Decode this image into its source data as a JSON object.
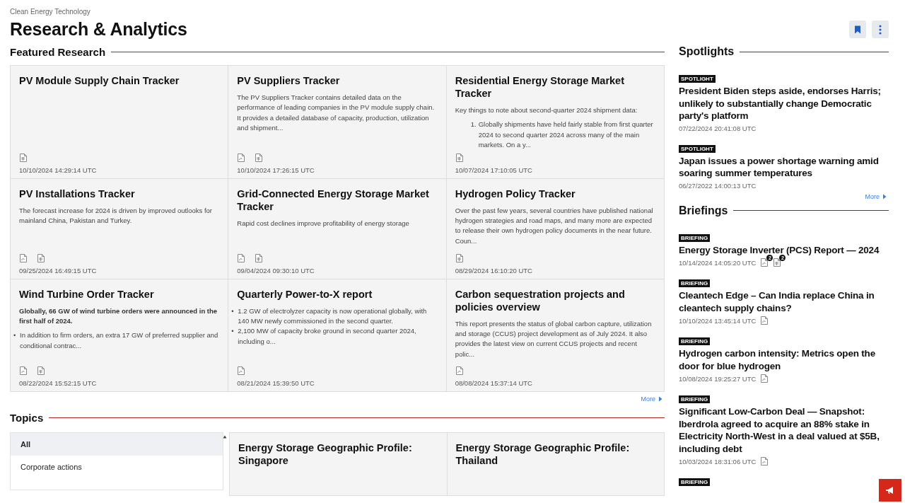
{
  "breadcrumb": "Clean Energy Technology",
  "title": "Research & Analytics",
  "actions": [
    {
      "kind": "bookmark"
    },
    {
      "kind": "more"
    }
  ],
  "featured": {
    "title": "Featured Research",
    "more": "More",
    "items": [
      {
        "title": "PV Module Supply Chain Tracker",
        "files": [
          {
            "kind": "xls"
          }
        ],
        "date": "10/10/2024 14:29:14 UTC"
      },
      {
        "title": "PV Suppliers Tracker",
        "body": [
          {
            "kind": "paragraph",
            "text": "The PV Suppliers Tracker contains detailed data on the performance of leading companies in the PV module supply chain. It provides a detailed database of capacity, production, utilization and shipment..."
          }
        ],
        "files": [
          {
            "kind": "pdf"
          },
          {
            "kind": "xls"
          }
        ],
        "date": "10/10/2024 17:26:15 UTC"
      },
      {
        "title": "Residential Energy Storage Market Tracker",
        "body": [
          {
            "kind": "paragraph",
            "text": "Key things to note about second-quarter 2024 shipment data:"
          },
          {
            "kind": "numbered_item",
            "marker": "1.",
            "text": "Globally shipments have held fairly stable from first quarter 2024 to second quarter 2024 across many of the main markets. On a y..."
          }
        ],
        "files": [
          {
            "kind": "xls"
          }
        ],
        "date": "10/07/2024 17:10:05 UTC"
      },
      {
        "title": "PV Installations Tracker",
        "body": [
          {
            "kind": "paragraph",
            "text": "The forecast increase for 2024 is driven by improved outlooks for mainland China, Pakistan and Turkey."
          }
        ],
        "files": [
          {
            "kind": "pdf"
          },
          {
            "kind": "xls"
          }
        ],
        "date": "09/25/2024 16:49:15 UTC"
      },
      {
        "title": "Grid-Connected Energy Storage Market Tracker",
        "body": [
          {
            "kind": "paragraph",
            "text": "Rapid cost declines improve profitability of energy storage"
          }
        ],
        "files": [
          {
            "kind": "pdf"
          },
          {
            "kind": "xls"
          }
        ],
        "date": "09/04/2024 09:30:10 UTC"
      },
      {
        "title": "Hydrogen Policy Tracker",
        "body": [
          {
            "kind": "paragraph",
            "text": "Over the past few years, several countries have published national hydrogen strategies and road maps, and many more are expected to release their own hydrogen policy documents in the near future. Coun..."
          }
        ],
        "files": [
          {
            "kind": "xls"
          }
        ],
        "date": "08/29/2024 16:10:20 UTC"
      },
      {
        "title": "Wind Turbine Order Tracker",
        "body": [
          {
            "kind": "lead",
            "text": "Globally, 66 GW of wind turbine orders were announced in the first half of 2024."
          },
          {
            "kind": "bullet_item",
            "marker": "•",
            "text": "In addition to firm orders, an extra 17 GW of preferred supplier and conditional contrac..."
          }
        ],
        "files": [
          {
            "kind": "pdf"
          },
          {
            "kind": "xls"
          }
        ],
        "date": "08/22/2024 15:52:15 UTC"
      },
      {
        "title": "Quarterly Power-to-X report",
        "body": [
          {
            "kind": "bullet_item",
            "marker": "•",
            "text": "1.2 GW of electrolyzer capacity is now operational globally, with 140 MW newly commissioned in the second quarter."
          },
          {
            "kind": "bullet_item",
            "marker": "•",
            "text": "2,100 MW of capacity broke ground in second quarter 2024, including o..."
          }
        ],
        "files": [
          {
            "kind": "pdf"
          }
        ],
        "date": "08/21/2024 15:39:50 UTC"
      },
      {
        "title": "Carbon sequestration projects and policies overview",
        "body": [
          {
            "kind": "paragraph",
            "text": "This report presents the status of global carbon capture, utilization and storage (CCUS) project development as of July 2024. It also provides the latest view on current CCUS projects and recent polic..."
          }
        ],
        "files": [
          {
            "kind": "pdf"
          }
        ],
        "date": "08/08/2024 15:37:14 UTC"
      }
    ]
  },
  "topics": {
    "title": "Topics",
    "list": [
      {
        "label": "All",
        "selected": true
      },
      {
        "label": "Corporate actions",
        "selected": false
      }
    ],
    "cards": [
      {
        "title": "Energy Storage Geographic Profile: Singapore"
      },
      {
        "title": "Energy Storage Geographic Profile: Thailand"
      }
    ]
  },
  "spotlights": {
    "title": "Spotlights",
    "more": "More",
    "items": [
      {
        "tag": "SPOTLIGHT",
        "title": "President Biden steps aside, endorses Harris; unlikely to substantially change Democratic party's platform",
        "date": "07/22/2024 20:41:08 UTC"
      },
      {
        "tag": "SPOTLIGHT",
        "title": "Japan issues a power shortage warning amid soaring summer temperatures",
        "date": "06/27/2022 14:00:13 UTC"
      }
    ]
  },
  "briefings": {
    "title": "Briefings",
    "items": [
      {
        "tag": "BRIEFING",
        "title": "Energy Storage Inverter (PCS) Report — 2024",
        "date": "10/14/2024 14:05:20 UTC",
        "files": [
          {
            "kind": "pdf",
            "count": "2"
          },
          {
            "kind": "xls",
            "count": "2"
          }
        ]
      },
      {
        "tag": "BRIEFING",
        "title": "Cleantech Edge – Can India replace China in cleantech supply chains?",
        "date": "10/10/2024 13:45:14 UTC",
        "files": [
          {
            "kind": "pdf"
          }
        ]
      },
      {
        "tag": "BRIEFING",
        "title": "Hydrogen carbon intensity: Metrics open the door for blue hydrogen",
        "date": "10/08/2024 19:25:27 UTC",
        "files": [
          {
            "kind": "pdf"
          }
        ]
      },
      {
        "tag": "BRIEFING",
        "title": "Significant Low-Carbon Deal — Snapshot: Iberdrola agreed to acquire an 88% stake in Electricity North-West in a deal valued at $5B, including debt",
        "date": "10/03/2024 18:31:06 UTC",
        "files": [
          {
            "kind": "pdf"
          }
        ]
      },
      {
        "tag": "BRIEFING"
      }
    ]
  }
}
